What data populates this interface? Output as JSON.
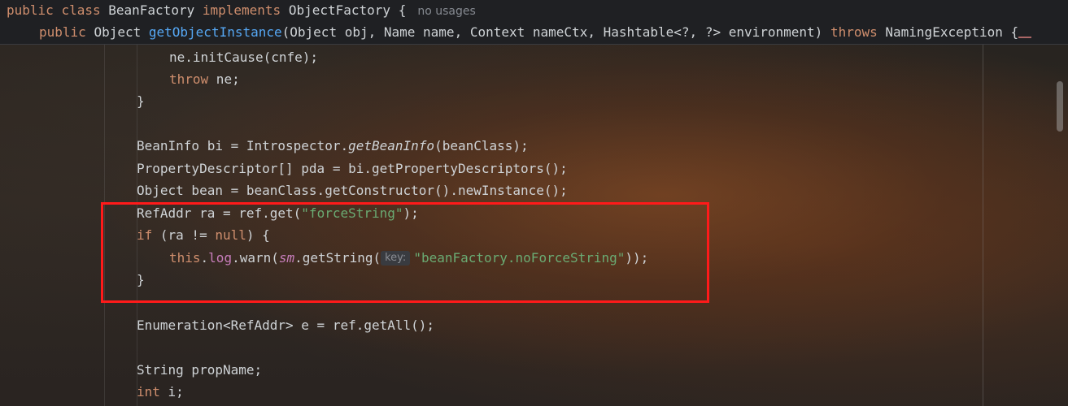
{
  "sticky_header": {
    "line1": {
      "kw_public": "public",
      "kw_class": "class",
      "class_name": "BeanFactory",
      "kw_implements": "implements",
      "interface_name": "ObjectFactory",
      "brace": "{",
      "usage_hint": "no usages"
    },
    "line2": {
      "kw_public": "public",
      "return_type": "Object",
      "method_name": "getObjectInstance",
      "params": "(Object obj, Name name, Context nameCtx, Hashtable<?, ?> environment)",
      "kw_throws": "throws",
      "exception": "NamingException",
      "brace": "{"
    }
  },
  "code": {
    "l1_text": "ne.initCause(cnfe);",
    "l2_kw": "throw",
    "l2_rest": " ne;",
    "l3_text": "}",
    "l5_a": "BeanInfo bi = Introspector.",
    "l5_method": "getBeanInfo",
    "l5_b": "(beanClass);",
    "l6_text": "PropertyDescriptor[] pda = bi.getPropertyDescriptors();",
    "l7_text": "Object bean = beanClass.getConstructor().newInstance();",
    "l8_a": "RefAddr ra = ref.get(",
    "l8_str": "\"forceString\"",
    "l8_b": ");",
    "l9_kw_if": "if",
    "l9_a": " (ra != ",
    "l9_kw_null": "null",
    "l9_b": ") {",
    "l10_kw_this": "this",
    "l10_dot": ".",
    "l10_field": "log",
    "l10_a": ".warn(",
    "l10_sm": "sm",
    "l10_b": ".getString(",
    "l10_hint": "key:",
    "l10_str": "\"beanFactory.noForceString\"",
    "l10_c": "));",
    "l11_text": "}",
    "l13_text": "Enumeration<RefAddr> e = ref.getAll();",
    "l15_text": "String propName;",
    "l16_kw": "int",
    "l16_rest": " i;"
  }
}
